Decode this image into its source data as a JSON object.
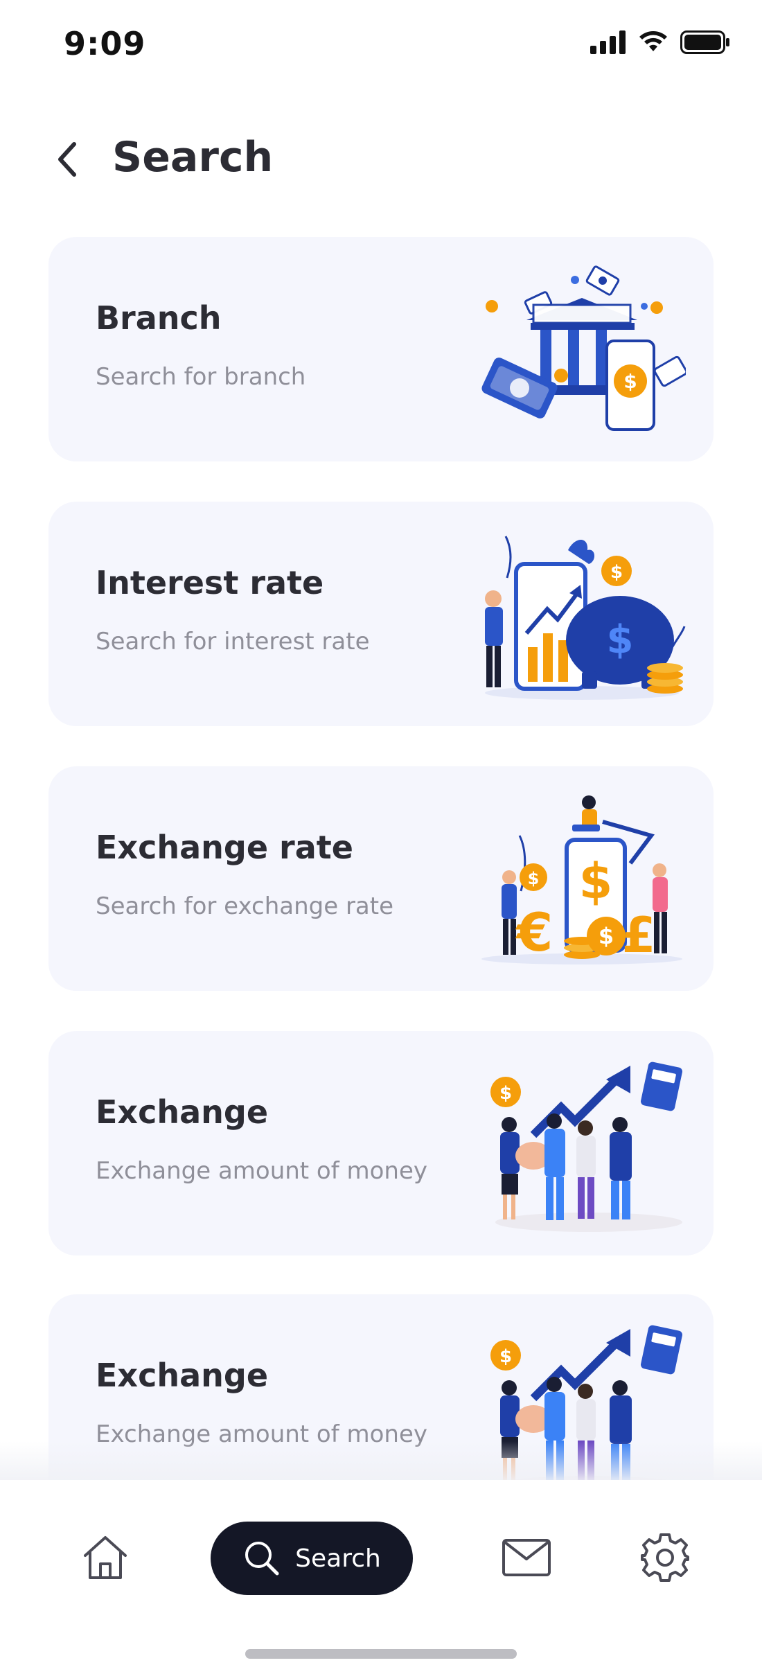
{
  "status_bar": {
    "time": "9:09"
  },
  "header": {
    "title": "Search"
  },
  "cards": [
    {
      "title": "Branch",
      "subtitle": "Search for branch",
      "illustration": "bank-illustration"
    },
    {
      "title": "Interest rate",
      "subtitle": "Search for interest rate",
      "illustration": "piggy-bank-growth-illustration"
    },
    {
      "title": "Exchange rate",
      "subtitle": "Search for exchange rate",
      "illustration": "currency-exchange-illustration"
    },
    {
      "title": "Exchange",
      "subtitle": "Exchange amount of money",
      "illustration": "team-celebration-illustration"
    },
    {
      "title": "Exchange",
      "subtitle": "Exchange amount of money",
      "illustration": "team-celebration-illustration"
    }
  ],
  "bottom_nav": {
    "home_icon": "home-icon",
    "search_label": "Search",
    "mail_icon": "mail-icon",
    "settings_icon": "gear-icon"
  },
  "colors": {
    "card_background": "#f5f6fd",
    "nav_active": "#141726",
    "accent_blue": "#1f4ed8",
    "accent_orange": "#f59e0b"
  }
}
